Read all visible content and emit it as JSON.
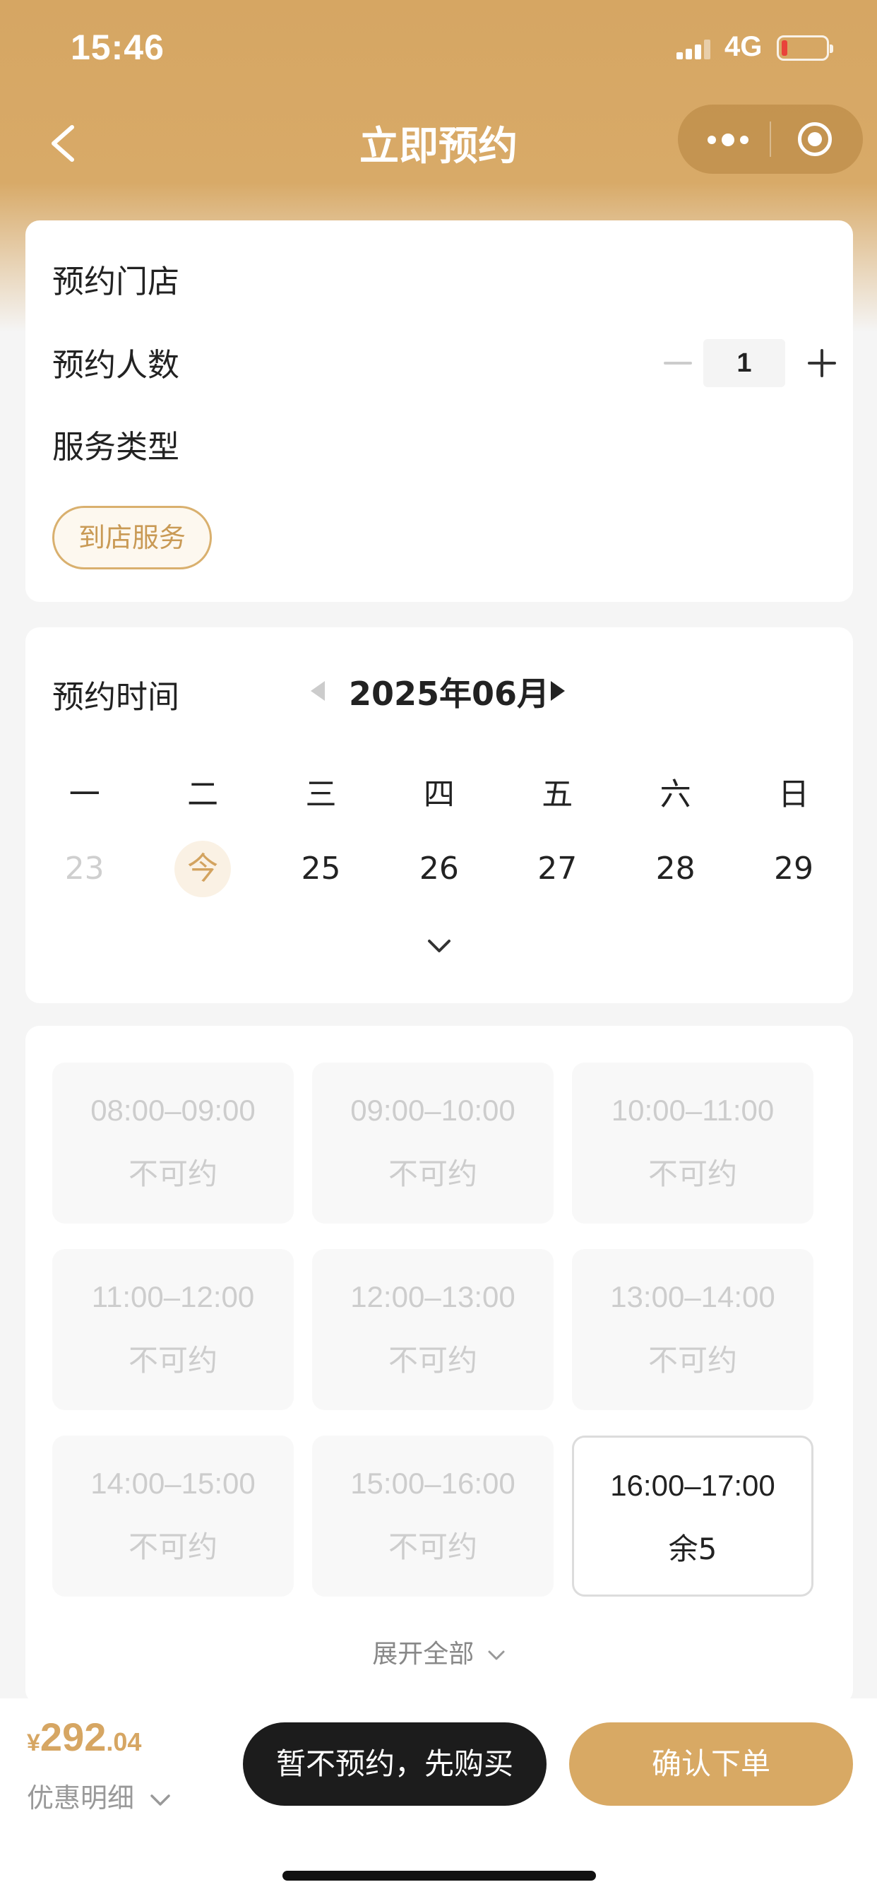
{
  "status_bar": {
    "time": "15:46",
    "network": "4G"
  },
  "nav": {
    "title": "立即预约"
  },
  "booking": {
    "store_label": "预约门店",
    "people_label": "预约人数",
    "people_count": "1",
    "service_type_label": "服务类型",
    "service_tag": "到店服务"
  },
  "calendar": {
    "label": "预约时间",
    "month": "2025年06月",
    "weekdays": [
      "一",
      "二",
      "三",
      "四",
      "五",
      "六",
      "日"
    ],
    "dates": [
      "23",
      "今",
      "25",
      "26",
      "27",
      "28",
      "29"
    ]
  },
  "slots": [
    {
      "time": "08:00–09:00",
      "status": "不可约"
    },
    {
      "time": "09:00–10:00",
      "status": "不可约"
    },
    {
      "time": "10:00–11:00",
      "status": "不可约"
    },
    {
      "time": "11:00–12:00",
      "status": "不可约"
    },
    {
      "time": "12:00–13:00",
      "status": "不可约"
    },
    {
      "time": "13:00–14:00",
      "status": "不可约"
    },
    {
      "time": "14:00–15:00",
      "status": "不可约"
    },
    {
      "time": "15:00–16:00",
      "status": "不可约"
    },
    {
      "time": "16:00–17:00",
      "status": "余5"
    }
  ],
  "expand_all": "展开全部",
  "footer": {
    "currency": "¥",
    "price_int": "292",
    "price_dec": ".04",
    "discount_label": "优惠明细",
    "buy_first": "暂不预约，先购买",
    "confirm": "确认下单"
  },
  "colors": {
    "accent": "#d6a663",
    "available_border": "#dcdcdc"
  }
}
